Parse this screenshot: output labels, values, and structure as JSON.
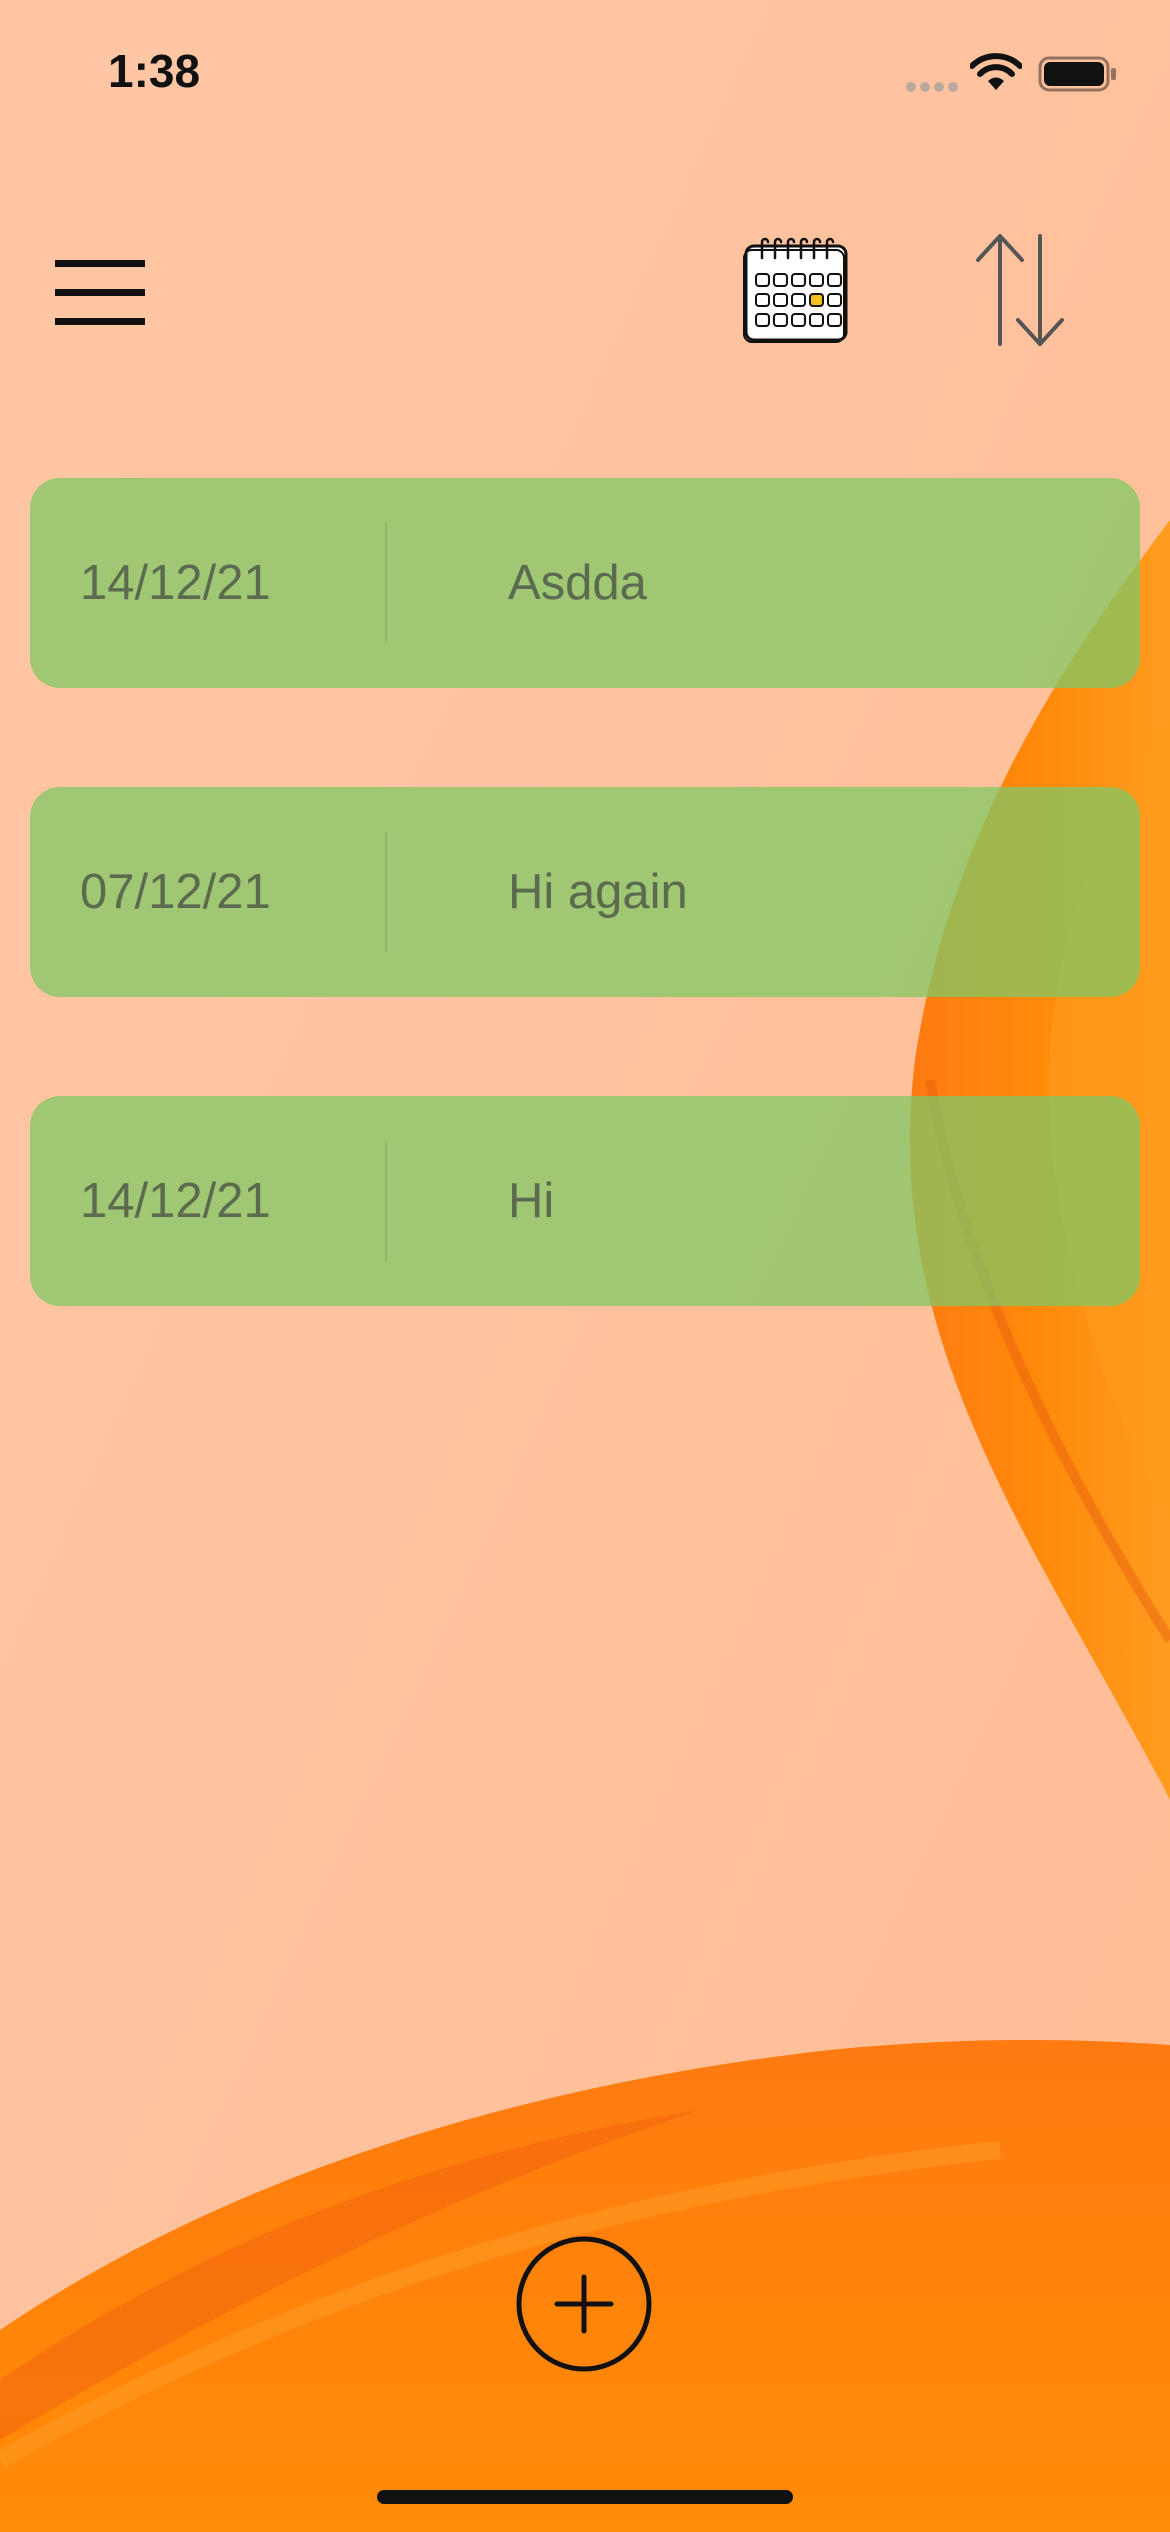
{
  "status_bar": {
    "time": "1:38",
    "icons": [
      "cellular-signal-icon",
      "wifi-icon",
      "battery-icon"
    ]
  },
  "toolbar": {
    "menu_icon": "hamburger-menu-icon",
    "calendar_icon": "calendar-icon",
    "sort_icon": "sort-arrows-icon"
  },
  "notes": [
    {
      "date": "14/12/21",
      "title": "Asdda"
    },
    {
      "date": "07/12/21",
      "title": "Hi again"
    },
    {
      "date": "14/12/21",
      "title": "Hi"
    }
  ],
  "footer": {
    "add_icon": "plus-circle-icon"
  },
  "colors": {
    "background": "#ffc3a1",
    "accent_orange": "#ff8a0a",
    "note_card": "#8cc46e",
    "note_text": "#5c6b4f"
  }
}
